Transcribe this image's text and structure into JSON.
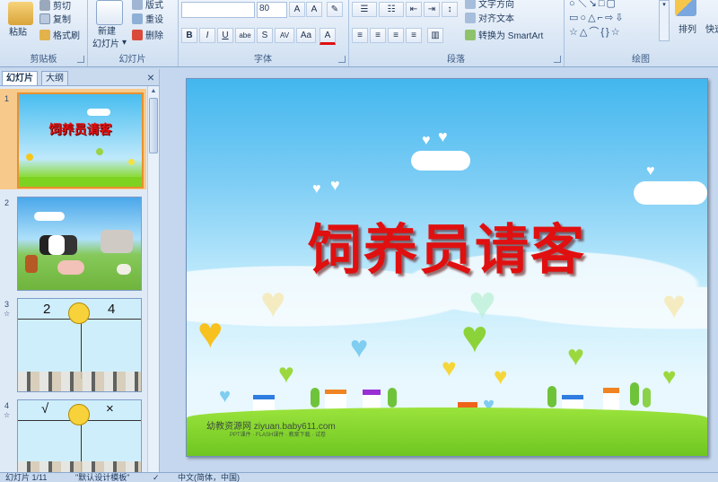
{
  "ribbon": {
    "clipboard": {
      "paste": "粘贴",
      "cut": "剪切",
      "copy": "复制",
      "format_painter": "格式刷",
      "label": "剪贴板"
    },
    "slides": {
      "new_slide": "新建",
      "new_slide_2": "幻灯片",
      "layout": "版式",
      "reset": "重设",
      "delete": "删除",
      "label": "幻灯片"
    },
    "font": {
      "font_size": "80",
      "label": "字体",
      "buttons": [
        "B",
        "I",
        "U",
        "abe",
        "S",
        "AV",
        "Aa",
        "A"
      ]
    },
    "paragraph": {
      "text_direction": "文字方向",
      "align_text": "对齐文本",
      "smartart": "转换为 SmartArt",
      "label": "段落"
    },
    "drawing": {
      "arrange": "排列",
      "quick": "快速",
      "label": "绘图"
    }
  },
  "pane": {
    "tab_slides": "幻灯片",
    "tab_outline": "大纲",
    "close": "×",
    "thumb_title": "饲养员请客",
    "thumb3": {
      "left": "2",
      "right": "4"
    },
    "thumb4": {
      "left": "√",
      "right": "×"
    },
    "numbers": [
      "1",
      "2",
      "3",
      "4"
    ],
    "star": "☆"
  },
  "slide": {
    "title": "饲养员请客",
    "watermark": "幼教资源网 ziyuan.baby611.com",
    "watermark_sub": "PPT课件 · FLASH课件 · 教案下载 · 试卷"
  },
  "status": {
    "slide_info": "幻灯片 1/11",
    "theme": "\"默认设计模板\"",
    "language": "中文(简体，中国)"
  },
  "colors": {
    "title_red": "#e01010",
    "sky_top": "#43b8ef",
    "grass": "#7ed321"
  }
}
